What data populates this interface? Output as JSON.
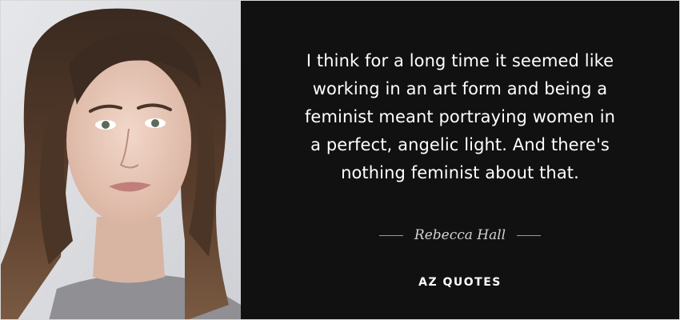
{
  "quote": {
    "lines": [
      "I think for a long time it seemed like",
      "working in an art form and being a",
      "feminist meant portraying women in",
      "a perfect, angelic light. And there's",
      "nothing feminist about that."
    ]
  },
  "author": {
    "name": "Rebecca Hall"
  },
  "brand": {
    "label": "AZ QUOTES"
  },
  "colors": {
    "panel_bg": "#111111",
    "photo_bg": "#dcdde1",
    "text": "#ffffff",
    "author_text": "#d2d2d2"
  }
}
